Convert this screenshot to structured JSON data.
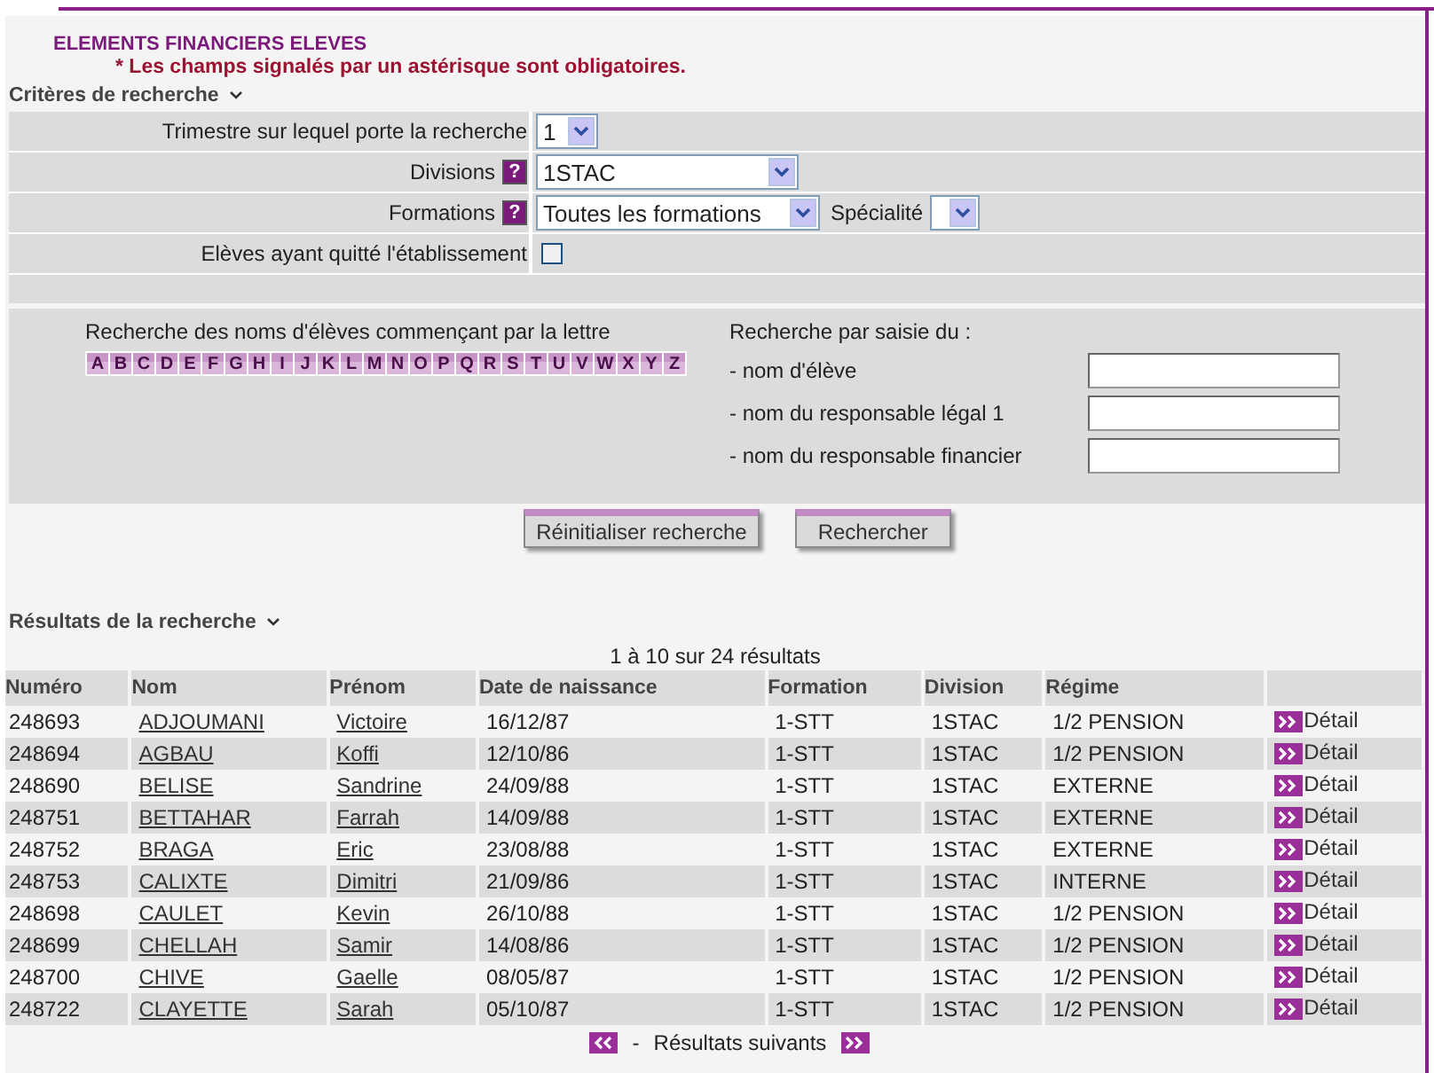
{
  "title": "ELEMENTS FINANCIERS ELEVES",
  "notice": "* Les champs signalés par un astérisque sont obligatoires.",
  "criteria": {
    "heading": "Critères de recherche",
    "fields": [
      {
        "kind": "select",
        "label": "Trimestre sur lequel porte la recherche",
        "value": "1"
      },
      {
        "kind": "select",
        "label": "Divisions",
        "help": "?",
        "value": "1STAC"
      },
      {
        "kind": "select",
        "label": "Formations",
        "help": "?",
        "value": "Toutes les formations",
        "extra_label": "Spécialité"
      },
      {
        "kind": "checkbox",
        "label": "Elèves ayant quitté l'établissement",
        "checked": false
      }
    ]
  },
  "letter_search": {
    "label": "Recherche des noms d'élèves commençant par la lettre",
    "letters": [
      "A",
      "B",
      "C",
      "D",
      "E",
      "F",
      "G",
      "H",
      "I",
      "J",
      "K",
      "L",
      "M",
      "N",
      "O",
      "P",
      "Q",
      "R",
      "S",
      "T",
      "U",
      "V",
      "W",
      "X",
      "Y",
      "Z"
    ]
  },
  "text_search": {
    "label": "Recherche par saisie du :",
    "fields": [
      {
        "label": "- nom d'élève"
      },
      {
        "label": "- nom du responsable légal 1"
      },
      {
        "label": "- nom du responsable financier"
      }
    ]
  },
  "buttons": [
    "Réinitialiser recherche",
    "Rechercher"
  ],
  "results": {
    "heading": "Résultats de la recherche",
    "count": "1 à 10 sur 24 résultats",
    "columns": [
      "Numéro",
      "Nom",
      "Prénom",
      "Date de naissance",
      "Formation",
      "Division",
      "Régime"
    ],
    "rows": [
      {
        "cells": [
          "248693",
          "ADJOUMANI",
          "Victoire",
          "16/12/87",
          "1-STT",
          "1STAC",
          "1/2 PENSION"
        ],
        "action": "Détail"
      },
      {
        "cells": [
          "248694",
          "AGBAU",
          "Koffi",
          "12/10/86",
          "1-STT",
          "1STAC",
          "1/2 PENSION"
        ],
        "action": "Détail"
      },
      {
        "cells": [
          "248690",
          "BELISE",
          "Sandrine",
          "24/09/88",
          "1-STT",
          "1STAC",
          "EXTERNE"
        ],
        "action": "Détail"
      },
      {
        "cells": [
          "248751",
          "BETTAHAR",
          "Farrah",
          "14/09/88",
          "1-STT",
          "1STAC",
          "EXTERNE"
        ],
        "action": "Détail"
      },
      {
        "cells": [
          "248752",
          "BRAGA",
          "Eric",
          "23/08/88",
          "1-STT",
          "1STAC",
          "EXTERNE"
        ],
        "action": "Détail"
      },
      {
        "cells": [
          "248753",
          "CALIXTE",
          "Dimitri",
          "21/09/86",
          "1-STT",
          "1STAC",
          "INTERNE"
        ],
        "action": "Détail"
      },
      {
        "cells": [
          "248698",
          "CAULET",
          "Kevin",
          "26/10/88",
          "1-STT",
          "1STAC",
          "1/2 PENSION"
        ],
        "action": "Détail"
      },
      {
        "cells": [
          "248699",
          "CHELLAH",
          "Samir",
          "14/08/86",
          "1-STT",
          "1STAC",
          "1/2 PENSION"
        ],
        "action": "Détail"
      },
      {
        "cells": [
          "248700",
          "CHIVE",
          "Gaelle",
          "08/05/87",
          "1-STT",
          "1STAC",
          "1/2 PENSION"
        ],
        "action": "Détail"
      },
      {
        "cells": [
          "248722",
          "CLAYETTE",
          "Sarah",
          "05/10/87",
          "1-STT",
          "1STAC",
          "1/2 PENSION"
        ],
        "action": "Détail"
      }
    ],
    "pager": {
      "separator": "-",
      "next": "Résultats suivants"
    }
  }
}
